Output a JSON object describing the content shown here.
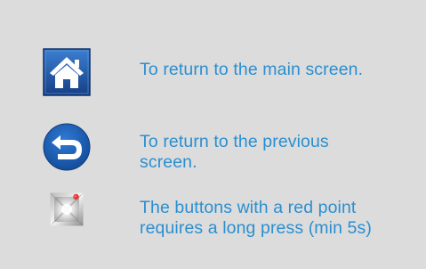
{
  "legend": {
    "items": [
      {
        "icon": "home-icon",
        "text": "To return to the main screen."
      },
      {
        "icon": "back-arrow-icon",
        "text": "To return to the previous screen."
      },
      {
        "icon": "long-press-icon",
        "text": "The buttons with a red point requires a long press (min 5s)"
      }
    ]
  },
  "colors": {
    "background": "#dcdcdc",
    "text": "#2b8fd0",
    "home_blue": "#1f59a8",
    "back_blue": "#1a5fb4",
    "red_point": "#e53935"
  }
}
